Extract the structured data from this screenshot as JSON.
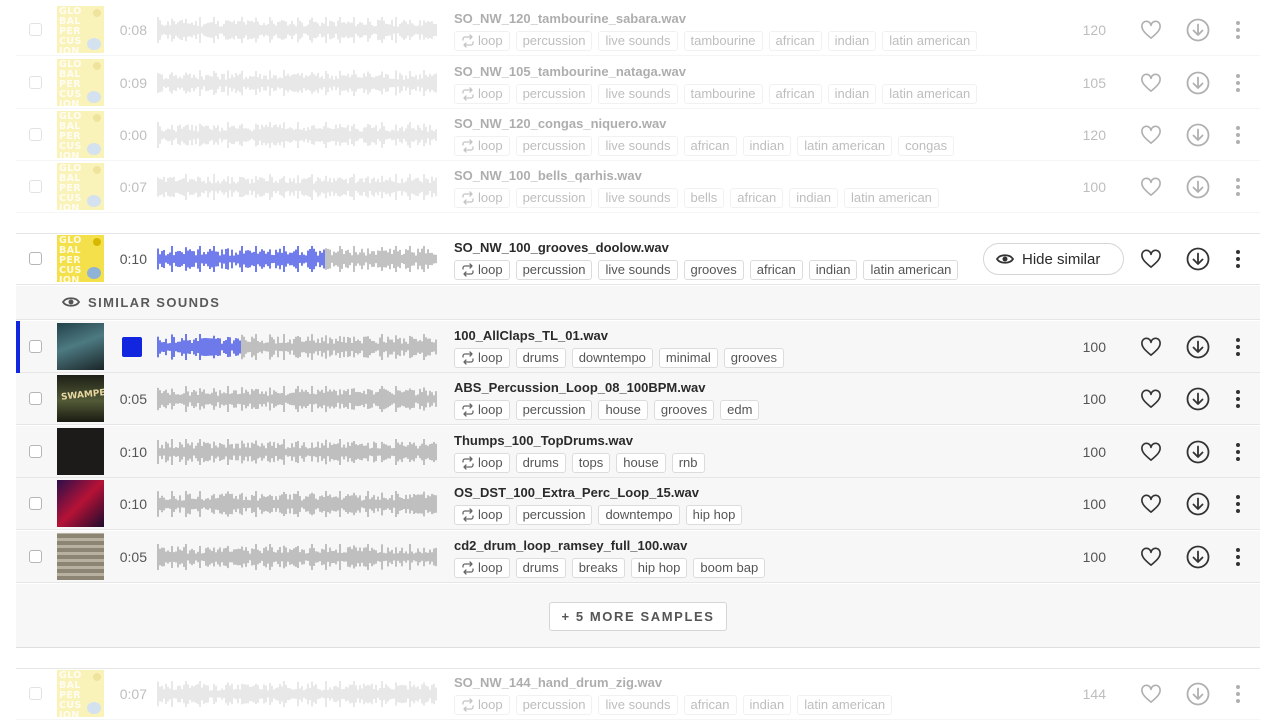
{
  "colors": {
    "accent": "#1226e0",
    "art_yellow": "#f4e04a"
  },
  "rows_top": [
    {
      "duration": "0:08",
      "filename": "SO_NW_120_tambourine_sabara.wav",
      "tags": [
        "loop",
        "percussion",
        "live sounds",
        "tambourine",
        "african",
        "indian",
        "latin american"
      ],
      "bpm": "120",
      "art_text": [
        "GLO",
        "BAL",
        "PER",
        "CUS",
        "ION"
      ]
    },
    {
      "duration": "0:09",
      "filename": "SO_NW_105_tambourine_nataga.wav",
      "tags": [
        "loop",
        "percussion",
        "live sounds",
        "tambourine",
        "african",
        "indian",
        "latin american"
      ],
      "bpm": "105",
      "art_text": [
        "GLO",
        "BAL",
        "PER",
        "CUS",
        "ION"
      ]
    },
    {
      "duration": "0:00",
      "filename": "SO_NW_120_congas_niquero.wav",
      "tags": [
        "loop",
        "percussion",
        "live sounds",
        "african",
        "indian",
        "latin american",
        "congas"
      ],
      "bpm": "120",
      "art_text": [
        "GLO",
        "BAL",
        "PER",
        "CUS",
        "ION"
      ]
    },
    {
      "duration": "0:07",
      "filename": "SO_NW_100_bells_qarhis.wav",
      "tags": [
        "loop",
        "percussion",
        "live sounds",
        "bells",
        "african",
        "indian",
        "latin american"
      ],
      "bpm": "100",
      "art_text": [
        "GLO",
        "BAL",
        "PER",
        "CUS",
        "ION"
      ]
    }
  ],
  "focus_row": {
    "duration": "0:10",
    "filename": "SO_NW_100_grooves_doolow.wav",
    "tags": [
      "loop",
      "percussion",
      "live sounds",
      "grooves",
      "african",
      "indian",
      "latin american"
    ],
    "hide_similar_label": "Hide similar",
    "art_text": [
      "GLO",
      "BAL",
      "PER",
      "CUS",
      "ION"
    ]
  },
  "similar_header": "SIMILAR SOUNDS",
  "similar_rows": [
    {
      "duration": "",
      "playing": true,
      "filename": "100_AllClaps_TL_01.wav",
      "tags": [
        "loop",
        "drums",
        "downtempo",
        "minimal",
        "grooves"
      ],
      "bpm": "100"
    },
    {
      "duration": "0:05",
      "filename": "ABS_Percussion_Loop_08_100BPM.wav",
      "tags": [
        "loop",
        "percussion",
        "house",
        "grooves",
        "edm"
      ],
      "bpm": "100",
      "art_text": "SWAMPED"
    },
    {
      "duration": "0:10",
      "filename": "Thumps_100_TopDrums.wav",
      "tags": [
        "loop",
        "drums",
        "tops",
        "house",
        "rnb"
      ],
      "bpm": "100"
    },
    {
      "duration": "0:10",
      "filename": "OS_DST_100_Extra_Perc_Loop_15.wav",
      "tags": [
        "loop",
        "percussion",
        "downtempo",
        "hip hop"
      ],
      "bpm": "100"
    },
    {
      "duration": "0:05",
      "filename": "cd2_drum_loop_ramsey_full_100.wav",
      "tags": [
        "loop",
        "drums",
        "breaks",
        "hip hop",
        "boom bap"
      ],
      "bpm": "100"
    }
  ],
  "more_samples_label": "+ 5 MORE SAMPLES",
  "bottom_row": {
    "duration": "0:07",
    "filename": "SO_NW_144_hand_drum_zig.wav",
    "tags": [
      "loop",
      "percussion",
      "live sounds",
      "african",
      "indian",
      "latin american"
    ],
    "bpm": "144",
    "art_text": [
      "GLO",
      "BAL",
      "PER",
      "CUS",
      "ION"
    ]
  }
}
